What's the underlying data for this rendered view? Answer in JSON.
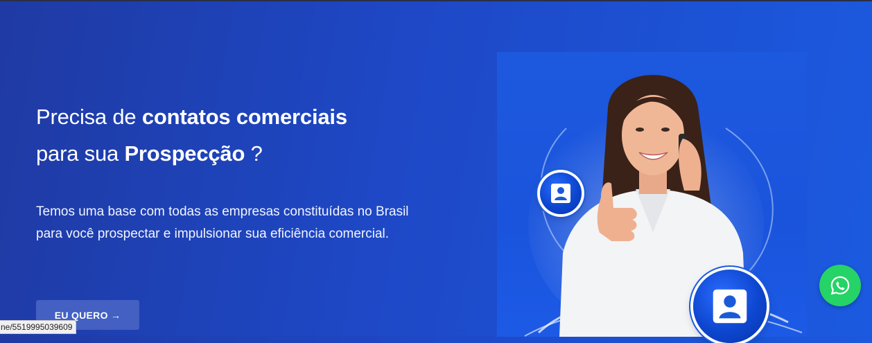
{
  "hero": {
    "headline": {
      "part1": "Precisa de ",
      "bold1": "contatos comerciais",
      "part2": "para sua ",
      "bold2": "Prospecção",
      "part3": " ?"
    },
    "description": "Temos uma base com todas as empresas constituídas no Brasil para você prospectar e impulsionar sua eficiência comercial.",
    "cta_label": "EU QUERO →"
  },
  "icons": {
    "badge_small": "contact-card-icon",
    "badge_large": "contact-card-icon",
    "whatsapp": "whatsapp-icon"
  },
  "status_bar": {
    "url": "ne/5519995039609"
  },
  "colors": {
    "background_start": "#1f3aa3",
    "background_end": "#1b5ae0",
    "cta_background": "#4360c2",
    "whatsapp_green": "#25d366"
  }
}
